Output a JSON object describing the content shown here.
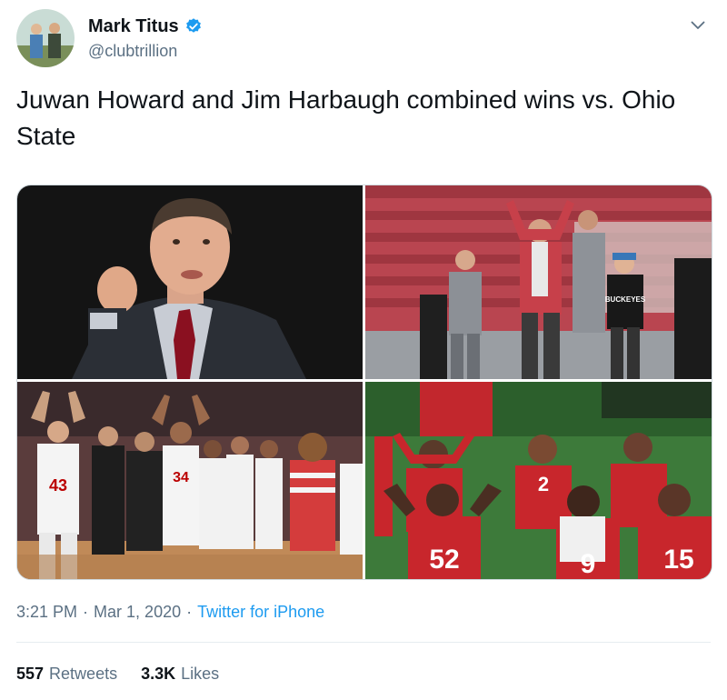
{
  "author": {
    "display_name": "Mark Titus",
    "handle": "@clubtrillion",
    "verified": true
  },
  "tweet": {
    "text": "Juwan Howard and Jim Harbaugh combined wins vs. Ohio State"
  },
  "media": {
    "photos": [
      {
        "description": "Coach in dark suit and red tie gesturing"
      },
      {
        "description": "Coach in red plaid jacket walking with staff in stadium"
      },
      {
        "description": "Basketball players in white jerseys making O-H-I-O gesture"
      },
      {
        "description": "Football players in red jerseys making O-H-I-O gesture"
      }
    ],
    "jersey_numbers": [
      "43",
      "34",
      "52",
      "15",
      "9",
      "2"
    ]
  },
  "meta": {
    "time": "3:21 PM",
    "separator": "·",
    "date": "Mar 1, 2020",
    "source": "Twitter for iPhone"
  },
  "stats": {
    "retweets_count": "557",
    "retweets_label": "Retweets",
    "likes_count": "3.3K",
    "likes_label": "Likes"
  },
  "colors": {
    "accent": "#1d9bf0",
    "secondary_text": "#5b7083",
    "buckeye_red": "#bb0000"
  },
  "icons": {
    "verified": "verified-badge-icon",
    "caret": "chevron-down-icon"
  }
}
